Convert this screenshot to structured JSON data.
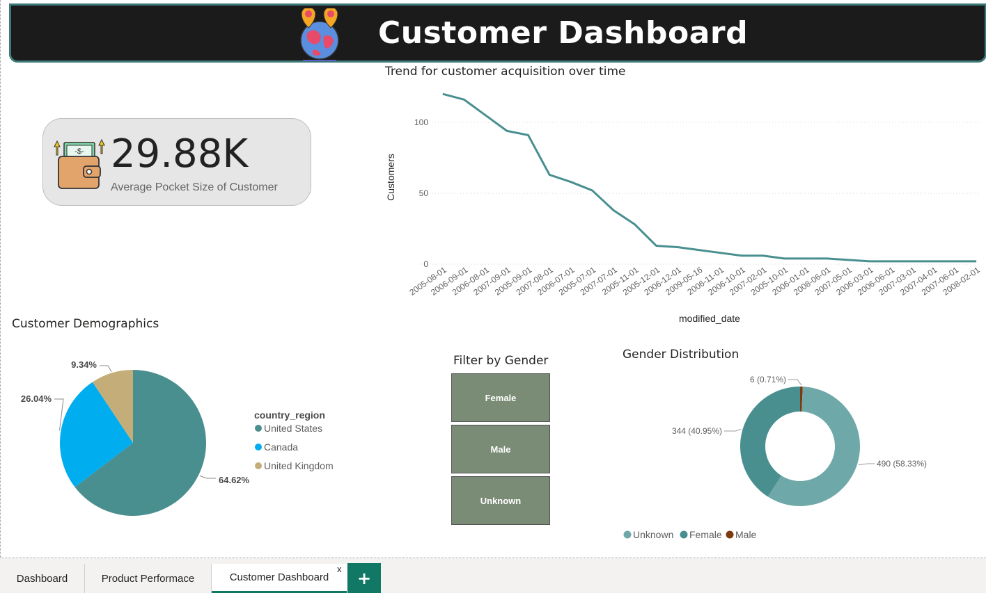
{
  "header": {
    "title": "Customer Dashboard",
    "logo": "globe-location-pins-icon"
  },
  "kpi": {
    "value": "29.88K",
    "label": "Average Pocket Size of Customer",
    "icon": "wallet-money-icon"
  },
  "line_chart_title": "Trend for customer acquisition over time",
  "demographics_title": "Customer Demographics",
  "slicer": {
    "title": "Filter by Gender",
    "options": [
      "Female",
      "Male",
      "Unknown"
    ]
  },
  "donut_title": "Gender Distribution",
  "tabs": [
    {
      "label": "Dashboard"
    },
    {
      "label": "Product Performace"
    },
    {
      "label": "Customer Dashboard",
      "active": true,
      "close": "x"
    }
  ],
  "add_tab": "+",
  "colors": {
    "header_bg": "#1b1b1b",
    "teal": "#4a8f8f",
    "light_teal": "#6fa8a8",
    "blue": "#00adef",
    "tan": "#c4ad78",
    "brown": "#7a3b10",
    "slicer": "#7a8b76",
    "accent": "#117865"
  },
  "chart_data": [
    {
      "type": "line",
      "title": "Trend for customer acquisition over time",
      "xlabel": "modified_date",
      "ylabel": "Customers",
      "ylim": [
        0,
        125
      ],
      "yticks": [
        0,
        50,
        100
      ],
      "grid": true,
      "categories": [
        "2005-08-01",
        "2006-09-01",
        "2006-08-01",
        "2007-09-01",
        "2005-09-01",
        "2007-08-01",
        "2006-07-01",
        "2005-07-01",
        "2007-07-01",
        "2005-11-01",
        "2005-12-01",
        "2006-12-01",
        "2009-05-16",
        "2006-11-01",
        "2006-10-01",
        "2007-02-01",
        "2005-10-01",
        "2006-01-01",
        "2008-06-01",
        "2007-05-01",
        "2006-03-01",
        "2006-06-01",
        "2007-03-01",
        "2007-04-01",
        "2007-06-01",
        "2008-02-01"
      ],
      "series": [
        {
          "values": [
            120,
            116,
            105,
            94,
            91,
            63,
            58,
            52,
            38,
            28,
            13,
            12,
            10,
            8,
            6,
            6,
            4,
            4,
            4,
            3,
            2,
            2,
            2,
            2,
            2,
            2
          ]
        }
      ]
    },
    {
      "type": "pie",
      "title": "Customer Demographics",
      "legend_title": "country_region",
      "legend_position": "right",
      "series": [
        {
          "name": "United States",
          "value": 64.62,
          "label": "64.62%",
          "color": "#4a8f8f"
        },
        {
          "name": "Canada",
          "value": 26.04,
          "label": "26.04%",
          "color": "#00adef"
        },
        {
          "name": "United Kingdom",
          "value": 9.34,
          "label": "9.34%",
          "color": "#c4ad78"
        }
      ]
    },
    {
      "type": "pie",
      "subtype": "donut",
      "title": "Gender Distribution",
      "legend_position": "bottom",
      "series": [
        {
          "name": "Unknown",
          "value": 490,
          "label": "490 (58.33%)",
          "color": "#6fa8a8"
        },
        {
          "name": "Female",
          "value": 344,
          "label": "344 (40.95%)",
          "color": "#4a8f8f"
        },
        {
          "name": "Male",
          "value": 6,
          "label": "6 (0.71%)",
          "color": "#7a3b10"
        }
      ]
    }
  ]
}
